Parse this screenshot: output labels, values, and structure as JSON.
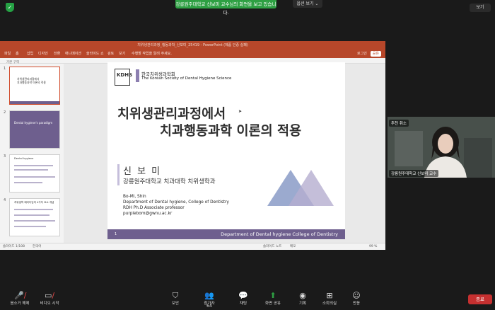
{
  "top": {
    "share_banner": "강릉원주대학교 신보미 교수님의 화면을 보고 있습니다.",
    "share_options": "옵션 보기 ⌄",
    "view_button": "보기"
  },
  "ppt": {
    "window_title": "치위생관리과정_행동과학_신보미_25419 - PowerPoint (제품 인증 실패)",
    "menu": [
      "파일",
      "홈",
      "삽입",
      "디자인",
      "전환",
      "애니메이션",
      "슬라이드 쇼",
      "검토",
      "보기"
    ],
    "tell_me": "수행할 작업을 알려 주세요.",
    "signin": "로그인",
    "share": "공유",
    "outline_label": "기본 구역",
    "status_left": "슬라이드 1/108",
    "status_lang": "한국어",
    "status_notes": "슬라이드 노트",
    "status_comments": "메모",
    "zoom": "99 %",
    "thumbs": [
      {
        "num": "1",
        "title": "치위생관리과정에서\n치과행동과학 이론의 적용"
      },
      {
        "num": "2",
        "title": "Dental hygiene's paradigm"
      },
      {
        "num": "3",
        "title": "Dental hygiene"
      },
      {
        "num": "4",
        "title": "치위생학 패러다임의 4가지 요소 개념"
      }
    ]
  },
  "slide": {
    "society_ko": "한국치위생과학회",
    "society_en": "The Korean Society of Dental Hygiene Science",
    "title_line1": "치위생관리과정에서",
    "title_line2": "치과행동과학 이론의 적용",
    "name": "신 보 미",
    "affil_ko": "강릉원주대학교 치과대학 치위생학과",
    "name_en": "Bo-Mi, Shin",
    "dept_en": "Department of Dental hygiene, College of Dentistry",
    "title_en": "RDH Ph.D Associate professor",
    "email": "purplebom@gwnu.ac.kr",
    "footer_num": "1",
    "footer_text": "Department of Dental hygiene College of Dentistry"
  },
  "webcam": {
    "label": "추천 취소",
    "name": "강릉원주대학교 신보미 교수"
  },
  "toolbar": {
    "mute": "음소거 해제",
    "video": "비디오 시작",
    "security": "보안",
    "participants": "참가자",
    "participants_count": "64",
    "chat": "채팅",
    "share": "화면 공유",
    "record": "기록",
    "breakout": "소회의실",
    "reactions": "반응",
    "end": "종료"
  },
  "colors": {
    "zoom_green": "#2ea043",
    "ppt_red": "#b7472a",
    "slide_purple": "#6e5f8e",
    "end_red": "#c53030"
  }
}
